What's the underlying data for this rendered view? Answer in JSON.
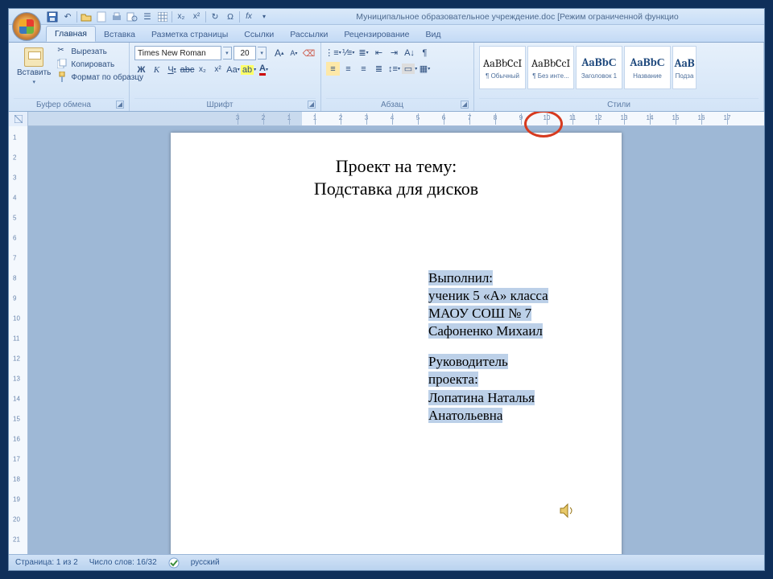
{
  "titlebar": {
    "title": "Муниципальное образовательное учреждение.doc [Режим ограниченной функцио"
  },
  "qat_icons": [
    "save",
    "undo",
    "redo",
    "open",
    "new",
    "print",
    "preview",
    "table",
    "columns",
    "ruler",
    "sub",
    "sup",
    "sym",
    "char",
    "func",
    "eq"
  ],
  "tabs": [
    "Главная",
    "Вставка",
    "Разметка страницы",
    "Ссылки",
    "Рассылки",
    "Рецензирование",
    "Вид"
  ],
  "clipboard": {
    "paste": "Вставить",
    "cut": "Вырезать",
    "copy": "Копировать",
    "format": "Формат по образцу",
    "group_label": "Буфер обмена"
  },
  "font": {
    "name": "Times New Roman",
    "size": "20",
    "group_label": "Шрифт"
  },
  "paragraph": {
    "group_label": "Абзац"
  },
  "styles": {
    "items": [
      {
        "preview": "AaBbCcI",
        "label": "¶ Обычный"
      },
      {
        "preview": "AaBbCcI",
        "label": "¶ Без инте..."
      },
      {
        "preview": "AaBbС",
        "label": "Заголовок 1",
        "heading": true
      },
      {
        "preview": "AaBbС",
        "label": "Название",
        "heading": true
      },
      {
        "preview": "AaB",
        "label": "Подза",
        "heading": true,
        "cut": true
      }
    ],
    "group_label": "Стили"
  },
  "ruler": {
    "h_nums": [
      "3",
      "2",
      "1",
      "1",
      "2",
      "3",
      "4",
      "5",
      "6",
      "7",
      "8",
      "9",
      "10",
      "11",
      "12",
      "13",
      "14",
      "15",
      "16",
      "17"
    ],
    "v_nums": [
      "1",
      "2",
      "3",
      "4",
      "5",
      "6",
      "7",
      "8",
      "9",
      "10",
      "11",
      "12",
      "13",
      "14",
      "15",
      "16",
      "17",
      "18",
      "19",
      "20",
      "21"
    ]
  },
  "document": {
    "title_line1": "Проект на тему:",
    "title_line2": "Подставка для дисков",
    "block1": [
      "Выполнил:",
      "ученик 5 «А» класса",
      "МАОУ СОШ № 7",
      "Сафоненко Михаил"
    ],
    "block2": [
      "Руководитель",
      "проекта:",
      "Лопатина Наталья",
      "Анатольевна"
    ]
  },
  "status": {
    "page": "Страница: 1 из 2",
    "words": "Число слов: 16/32",
    "lang": "русский"
  },
  "annotation": {
    "red_circle_target": "hruler tab stop near 9–11"
  }
}
